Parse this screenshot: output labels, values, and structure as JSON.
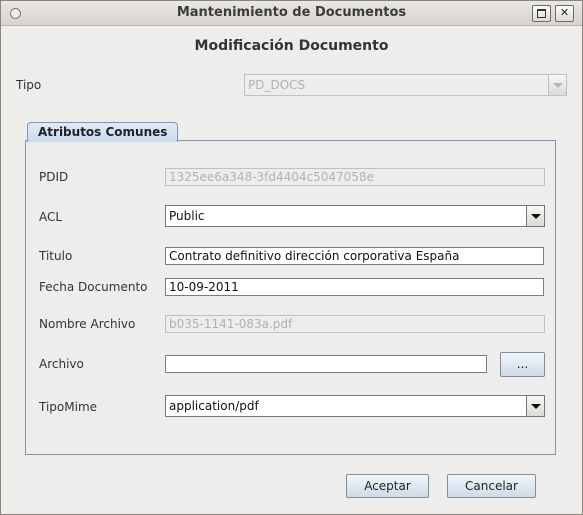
{
  "window": {
    "title": "Mantenimiento de Documentos"
  },
  "heading": "Modificación Documento",
  "tipo": {
    "label": "Tipo",
    "value": "PD_DOCS"
  },
  "tab": {
    "label": "Atributos Comunes"
  },
  "fields": {
    "pdid": {
      "label": "PDID",
      "value": "1325ee6a348-3fd4404c5047058e"
    },
    "acl": {
      "label": "ACL",
      "value": "Public"
    },
    "titulo": {
      "label": "Titulo",
      "value": "Contrato definitivo dirección corporativa España"
    },
    "fecha": {
      "label": "Fecha Documento",
      "value": "10-09-2011"
    },
    "nombre_archivo": {
      "label": "Nombre Archivo",
      "value": "b035-1141-083a.pdf"
    },
    "archivo": {
      "label": "Archivo",
      "value": "",
      "browse_label": "..."
    },
    "tipomime": {
      "label": "TipoMime",
      "value": "application/pdf"
    }
  },
  "buttons": {
    "accept": "Aceptar",
    "cancel": "Cancelar"
  }
}
